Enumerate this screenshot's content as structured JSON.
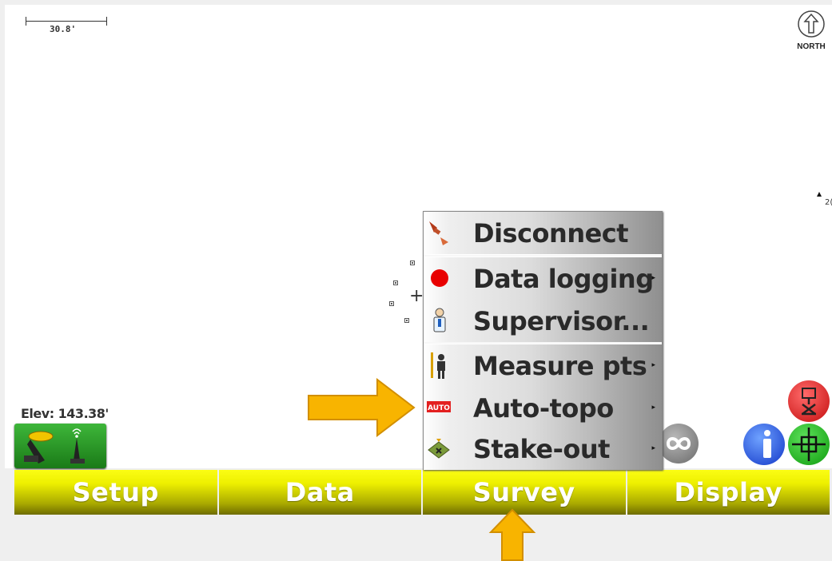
{
  "map": {
    "scale_label": "30.8'",
    "north_label": "NORTH",
    "point_label": "2(",
    "elevation": "Elev: 143.38'"
  },
  "icons": {
    "north": "north-arrow-icon",
    "connection": "gnss-receiver-icon",
    "infinity": "infinity-icon",
    "info": "info-icon",
    "target": "crosshair-target-icon",
    "red": "stakeout-red-icon"
  },
  "menu": {
    "items": [
      {
        "label": "Disconnect",
        "icon": "disconnect-plug-icon",
        "submenu": false
      },
      {
        "label": "Data logging",
        "icon": "record-dot-icon",
        "submenu": true
      },
      {
        "label": "Supervisor...",
        "icon": "supervisor-person-icon",
        "submenu": false
      },
      {
        "label": "Measure pts",
        "icon": "surveyor-pole-icon",
        "submenu": true
      },
      {
        "label": "Auto-topo",
        "icon": "auto-badge-icon",
        "submenu": true
      },
      {
        "label": "Stake-out",
        "icon": "stakeout-icon",
        "submenu": true
      }
    ],
    "submenu_glyph": "▸"
  },
  "tabs": [
    "Setup",
    "Data",
    "Survey",
    "Display"
  ],
  "colors": {
    "tab_yellow": "#eef000",
    "arrow_orange": "#f8b400",
    "menu_gray": "#bbbbbb"
  }
}
